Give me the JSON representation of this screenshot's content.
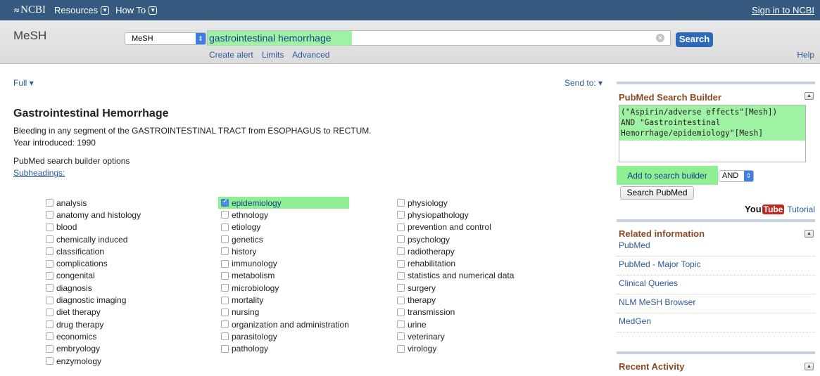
{
  "topbar": {
    "logo_text": "NCBI",
    "nav": [
      {
        "label": "Resources"
      },
      {
        "label": "How To"
      }
    ],
    "signin": "Sign in to NCBI"
  },
  "search": {
    "db_title": "MeSH",
    "db_select": "MeSH",
    "query": "gastrointestinal hemorrhage",
    "button": "Search",
    "links": [
      "Create alert",
      "Limits",
      "Advanced"
    ],
    "help": "Help"
  },
  "main": {
    "format": "Full",
    "send_to": "Send to:",
    "title": "Gastrointestinal Hemorrhage",
    "description": "Bleeding in any segment of the GASTROINTESTINAL TRACT from ESOPHAGUS to RECTUM.",
    "year": "Year introduced: 1990",
    "options_label": "PubMed search builder options",
    "subheadings_label": "Subheadings:",
    "subheadings": {
      "col1": [
        "analysis",
        "anatomy and histology",
        "blood",
        "chemically induced",
        "classification",
        "complications",
        "congenital",
        "diagnosis",
        "diagnostic imaging",
        "diet therapy",
        "drug therapy",
        "economics",
        "embryology",
        "enzymology"
      ],
      "col2": [
        "epidemiology",
        "ethnology",
        "etiology",
        "genetics",
        "history",
        "immunology",
        "metabolism",
        "microbiology",
        "mortality",
        "nursing",
        "organization and administration",
        "parasitology",
        "pathology"
      ],
      "col3": [
        "physiology",
        "physiopathology",
        "prevention and control",
        "psychology",
        "radiotherapy",
        "rehabilitation",
        "statistics and numerical data",
        "surgery",
        "therapy",
        "transmission",
        "urine",
        "veterinary",
        "virology"
      ],
      "checked": "epidemiology"
    }
  },
  "sidebar": {
    "builder_title": "PubMed Search Builder",
    "builder_text": "(\"Aspirin/adverse effects\"[Mesh])\nAND \"Gastrointestinal\nHemorrhage/epidemiology\"[Mesh]",
    "add_button": "Add to search builder",
    "operator": "AND",
    "search_pubmed": "Search PubMed",
    "youtube_you": "You",
    "youtube_tube": "Tube",
    "tutorial": "Tutorial",
    "related_title": "Related information",
    "related": [
      "PubMed",
      "PubMed - Major Topic",
      "Clinical Queries",
      "NLM MeSH Browser",
      "MedGen"
    ],
    "recent_title": "Recent Activity"
  },
  "colors": {
    "topbar": "#35597f",
    "highlight": "#8ef093",
    "link": "#2d5a9b",
    "section_title": "#8b4a21"
  }
}
